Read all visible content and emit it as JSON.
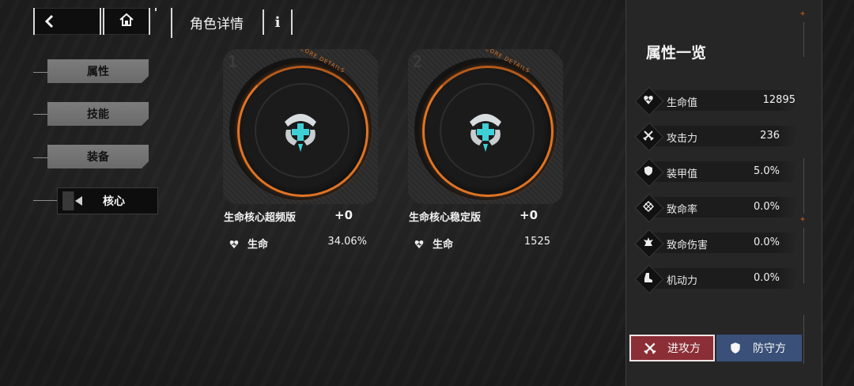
{
  "header": {
    "title": "角色详情",
    "info_label": "i"
  },
  "nav": {
    "items": [
      {
        "label": "属性",
        "active": false
      },
      {
        "label": "技能",
        "active": false
      },
      {
        "label": "装备",
        "active": false
      },
      {
        "label": "核心",
        "active": true
      }
    ]
  },
  "cores": [
    {
      "slot": "1",
      "ring_text": "CORE DETAILS",
      "name": "生命核心超频版",
      "level": "+0",
      "stat_label": "生命",
      "stat_value": "34.06%"
    },
    {
      "slot": "2",
      "ring_text": "CORE DETAILS",
      "name": "生命核心稳定版",
      "level": "+0",
      "stat_label": "生命",
      "stat_value": "1525"
    }
  ],
  "panel": {
    "title": "属性一览",
    "stats": [
      {
        "icon": "heart-icon",
        "label": "生命值",
        "value": "12895"
      },
      {
        "icon": "crossed-swords-icon",
        "label": "攻击力",
        "value": "236"
      },
      {
        "icon": "shield-icon",
        "label": "装甲值",
        "value": "5.0%"
      },
      {
        "icon": "crit-target-icon",
        "label": "致命率",
        "value": "0.0%"
      },
      {
        "icon": "explosion-icon",
        "label": "致命伤害",
        "value": "0.0%"
      },
      {
        "icon": "boot-icon",
        "label": "机动力",
        "value": "0.0%"
      }
    ],
    "attack_label": "进攻方",
    "defend_label": "防守方"
  },
  "colors": {
    "accent_orange": "#e07424",
    "attack_red": "#8b2e36",
    "defend_blue": "#3a5078",
    "emblem_cyan": "#3fd0d6"
  }
}
